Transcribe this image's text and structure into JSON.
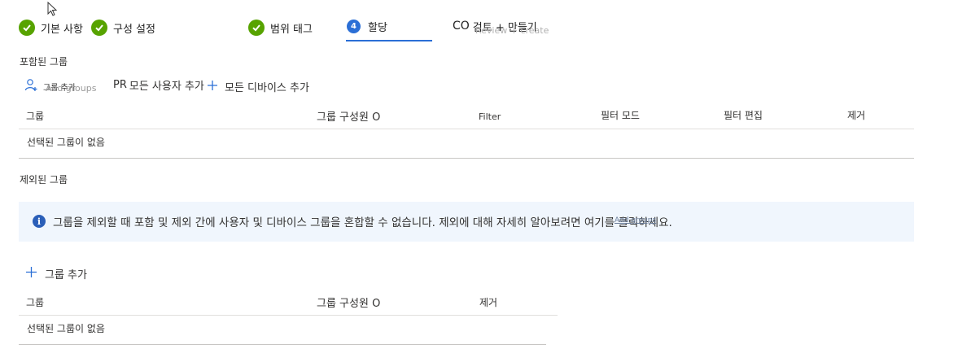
{
  "steps": [
    {
      "label": "기본 사항",
      "state": "done"
    },
    {
      "label": "구성 설정",
      "state": "done"
    },
    {
      "label": "범위 태그",
      "state": "done"
    },
    {
      "number": "4",
      "label": "할당",
      "state": "active"
    },
    {
      "prefix": "CO",
      "label": "검토 + 만들기",
      "state": "pending"
    }
  ],
  "ghost_text": {
    "step5": "Review + create",
    "add_groups": "Add groups"
  },
  "included": {
    "title": "포함된 그룹",
    "add_groups_label": "그룹 추가",
    "add_all_users_prefix": "PR",
    "add_all_users_label": "모든 사용자 추가",
    "add_all_devices_label": "모든 디바이스 추가",
    "columns": [
      "그룹",
      "그룹 구성원 O",
      "Filter",
      "필터 모드",
      "필터 편집",
      "제거"
    ],
    "empty_text": "선택된 그룹이 없음"
  },
  "excluded": {
    "title": "제외된 그룹",
    "info_text": "그룹을 제외할 때 포함 및 제외 간에 사용자 및 디바이스 그룹을 혼합할 수 없습니다. 제외에 대해 자세히 알아보려면 여기를 클릭하세요.",
    "info_link": "Add groups",
    "add_groups_label": "그룹 추가",
    "columns": [
      "그룹",
      "그룹 구성원 O",
      "제거"
    ],
    "empty_text": "선택된 그룹이 없음"
  },
  "colors": {
    "done": "#57a300",
    "active": "#2b6fd6",
    "info_bg": "#f0f6fd"
  }
}
